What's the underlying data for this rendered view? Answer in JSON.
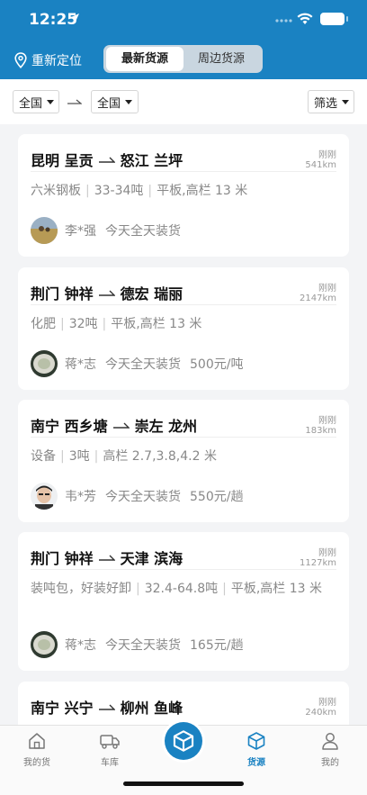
{
  "status": {
    "time": "12:25"
  },
  "header": {
    "relocate_label": "重新定位",
    "tabs": [
      {
        "label": "最新货源"
      },
      {
        "label": "周边货源"
      }
    ]
  },
  "filters": {
    "from": "全国",
    "to": "全国",
    "filter_label": "筛选"
  },
  "cards": [
    {
      "from": "昆明 呈贡",
      "to": "怒江 兰坪",
      "time": "刚刚",
      "distance": "541km",
      "goods": "六米钢板",
      "weight": "33-34吨",
      "truck": "平板,高栏 13 米",
      "name": "李*强",
      "load_time": "今天全天装货",
      "price": ""
    },
    {
      "from": "荆门 钟祥",
      "to": "德宏 瑞丽",
      "time": "刚刚",
      "distance": "2147km",
      "goods": "化肥",
      "weight": "32吨",
      "truck": "平板,高栏 13 米",
      "name": "蒋*志",
      "load_time": "今天全天装货",
      "price": "500元/吨"
    },
    {
      "from": "南宁 西乡塘",
      "to": "崇左 龙州",
      "time": "刚刚",
      "distance": "183km",
      "goods": "设备",
      "weight": "3吨",
      "truck": "高栏 2.7,3.8,4.2 米",
      "name": "韦*芳",
      "load_time": "今天全天装货",
      "price": "550元/趟"
    },
    {
      "from": "荆门 钟祥",
      "to": "天津 滨海",
      "time": "刚刚",
      "distance": "1127km",
      "goods": "装吨包，好装好卸",
      "weight": "32.4-64.8吨",
      "truck": "平板,高栏 13 米",
      "name": "蒋*志",
      "load_time": "今天全天装货",
      "price": "165元/趟"
    },
    {
      "from": "南宁 兴宁",
      "to": "柳州 鱼峰",
      "time": "刚刚",
      "distance": "240km"
    }
  ],
  "tabbar": {
    "items": [
      {
        "label": "我的货",
        "icon": "home-icon"
      },
      {
        "label": "车库",
        "icon": "truck-icon"
      },
      {
        "label": "货源",
        "icon": "cube-icon"
      },
      {
        "label": "我的",
        "icon": "person-icon"
      }
    ],
    "active_color": "#1a82c2"
  },
  "colors": {
    "brand": "#1a82c2",
    "background": "#f3f4f6"
  }
}
